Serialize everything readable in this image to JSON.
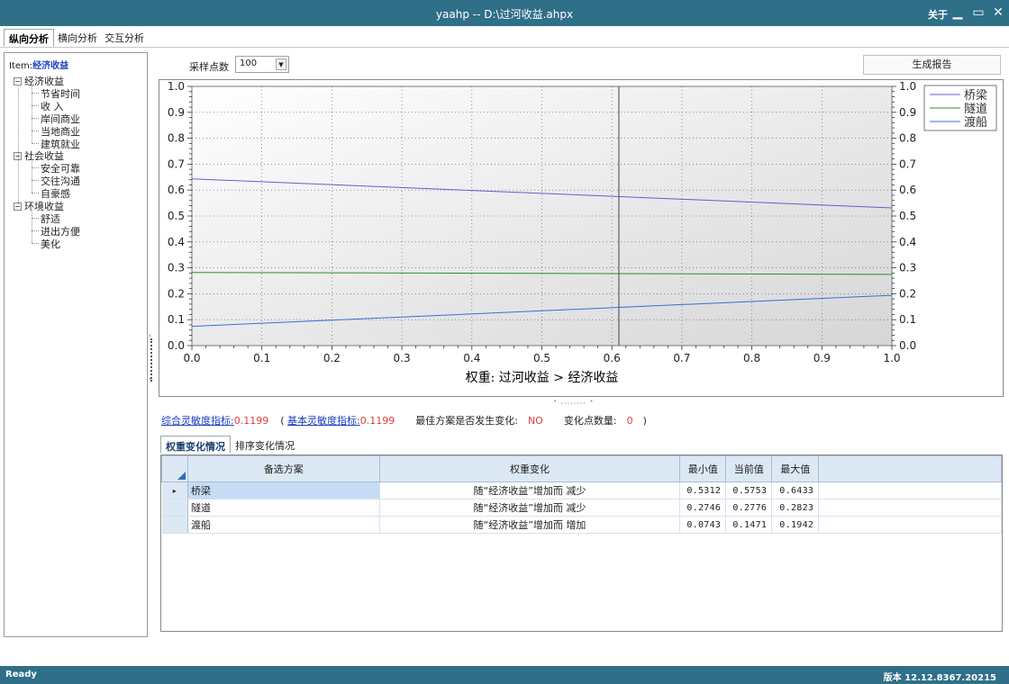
{
  "window": {
    "title": "yaahp -- D:\\过河收益.ahpx",
    "about_label": "关于",
    "minimize_glyph": "▁",
    "maximize_glyph": "▭",
    "close_glyph": "✕"
  },
  "main_tabs": [
    {
      "label": "纵向分析",
      "active": true
    },
    {
      "label": "横向分析",
      "active": false
    },
    {
      "label": "交互分析",
      "active": false
    }
  ],
  "tree": {
    "item_prefix": "Item:",
    "item_value": "经济收益",
    "nodes": [
      {
        "label": "经济收益",
        "level": 0,
        "toggle": "−"
      },
      {
        "label": "节省时间",
        "level": 1
      },
      {
        "label": "收 入",
        "level": 1
      },
      {
        "label": "岸间商业",
        "level": 1
      },
      {
        "label": "当地商业",
        "level": 1
      },
      {
        "label": "建筑就业",
        "level": 1
      },
      {
        "label": "社会收益",
        "level": 0,
        "toggle": "−"
      },
      {
        "label": "安全可靠",
        "level": 1
      },
      {
        "label": "交往沟通",
        "level": 1
      },
      {
        "label": "自豪感",
        "level": 1
      },
      {
        "label": "环境收益",
        "level": 0,
        "toggle": "−"
      },
      {
        "label": "舒适",
        "level": 1
      },
      {
        "label": "进出方便",
        "level": 1
      },
      {
        "label": "美化",
        "level": 1
      }
    ]
  },
  "controls": {
    "sample_label": "采样点数",
    "sample_value": "100",
    "report_button": "生成报告"
  },
  "chart_data": {
    "type": "line",
    "xlabel": "权重: 过河收益 > 经济收益",
    "ylabel": "",
    "xlim": [
      0.0,
      1.0
    ],
    "ylim": [
      0.0,
      1.0
    ],
    "x_ticks": [
      "0.0",
      "0.1",
      "0.2",
      "0.3",
      "0.4",
      "0.5",
      "0.6",
      "0.7",
      "0.8",
      "0.9",
      "1.0"
    ],
    "y_ticks": [
      "0.0",
      "0.1",
      "0.2",
      "0.3",
      "0.4",
      "0.5",
      "0.6",
      "0.7",
      "0.8",
      "0.9",
      "1.0"
    ],
    "grid": true,
    "legend_position": "top-right",
    "current_x": 0.61,
    "series": [
      {
        "name": "桥梁",
        "color": "#6a5acd",
        "x": [
          0.0,
          1.0
        ],
        "y": [
          0.6433,
          0.5312
        ]
      },
      {
        "name": "隧道",
        "color": "#2e8b3e",
        "x": [
          0.0,
          1.0
        ],
        "y": [
          0.2823,
          0.2746
        ]
      },
      {
        "name": "渡船",
        "color": "#3a6fd0",
        "x": [
          0.0,
          1.0
        ],
        "y": [
          0.0743,
          0.1942
        ]
      }
    ]
  },
  "sensitivity": {
    "composite_label": "综合灵敏度指标:",
    "composite_value": "0.1199",
    "open_paren": "(",
    "basic_label": "基本灵敏度指标:",
    "basic_value": "0.1199",
    "best_change_label": "最佳方案是否发生变化:",
    "best_change_value": "NO",
    "change_count_label": "变化点数量:",
    "change_count_value": "0",
    "close_paren": ")"
  },
  "sub_tabs": [
    {
      "label": "权重变化情况",
      "active": true
    },
    {
      "label": "排序变化情况",
      "active": false
    }
  ],
  "grid": {
    "headers": {
      "name": "备选方案",
      "change": "权重变化",
      "min": "最小值",
      "current": "当前值",
      "max": "最大值"
    },
    "rows": [
      {
        "marker": "▸",
        "name": "桥梁",
        "change": "随“经济收益”增加而 减少",
        "min": "0.5312",
        "current": "0.5753",
        "max": "0.6433"
      },
      {
        "marker": "",
        "name": "隧道",
        "change": "随“经济收益”增加而 减少",
        "min": "0.2746",
        "current": "0.2776",
        "max": "0.2823"
      },
      {
        "marker": "",
        "name": "渡船",
        "change": "随“经济收益”增加而 增加",
        "min": "0.0743",
        "current": "0.1471",
        "max": "0.1942"
      }
    ]
  },
  "status": {
    "left": "Ready",
    "right": "版本 12.12.8367.20215"
  }
}
